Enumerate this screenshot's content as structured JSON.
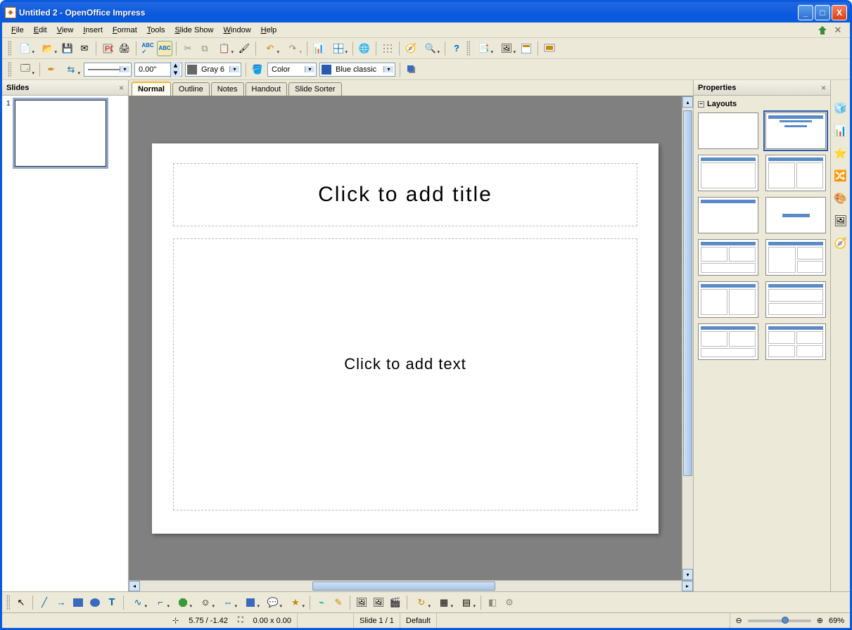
{
  "window": {
    "title": "Untitled 2 - OpenOffice Impress"
  },
  "menu": {
    "items": [
      "File",
      "Edit",
      "View",
      "Insert",
      "Format",
      "Tools",
      "Slide Show",
      "Window",
      "Help"
    ]
  },
  "toolbar2": {
    "line_width": "0.00\"",
    "color_name": "Gray 6",
    "area_mode": "Color",
    "area_color": "Blue classic"
  },
  "slidepanel": {
    "title": "Slides",
    "slides": [
      {
        "num": "1"
      }
    ]
  },
  "viewtabs": [
    "Normal",
    "Outline",
    "Notes",
    "Handout",
    "Slide Sorter"
  ],
  "slide": {
    "title_placeholder": "Click to add title",
    "body_placeholder": "Click to add text"
  },
  "properties": {
    "title": "Properties",
    "section": "Layouts"
  },
  "status": {
    "coords": "5.75 / -1.42",
    "size": "0.00 x 0.00",
    "slide_n": "Slide 1 / 1",
    "master": "Default",
    "zoom": "69%"
  }
}
